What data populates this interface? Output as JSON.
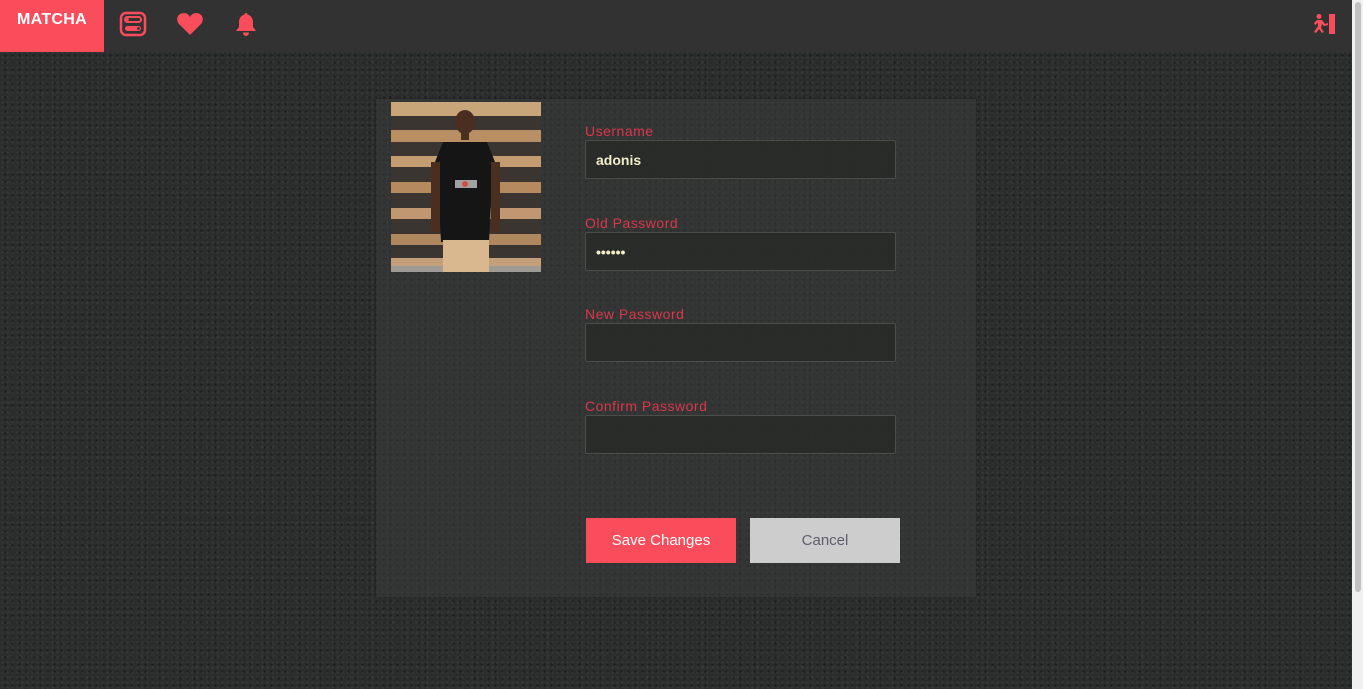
{
  "navbar": {
    "brand": "MATCHA",
    "icons": [
      "toggle-icon",
      "heart-icon",
      "bell-icon",
      "logout-icon"
    ],
    "accent": "#fa4d5b"
  },
  "form": {
    "username_label": "Username",
    "username_value": "adonis",
    "old_password_label": "Old Password",
    "old_password_value": "••••••",
    "new_password_label": "New Password",
    "new_password_value": "",
    "confirm_password_label": "Confirm Password",
    "confirm_password_value": ""
  },
  "buttons": {
    "save_label": "Save Changes",
    "cancel_label": "Cancel"
  }
}
